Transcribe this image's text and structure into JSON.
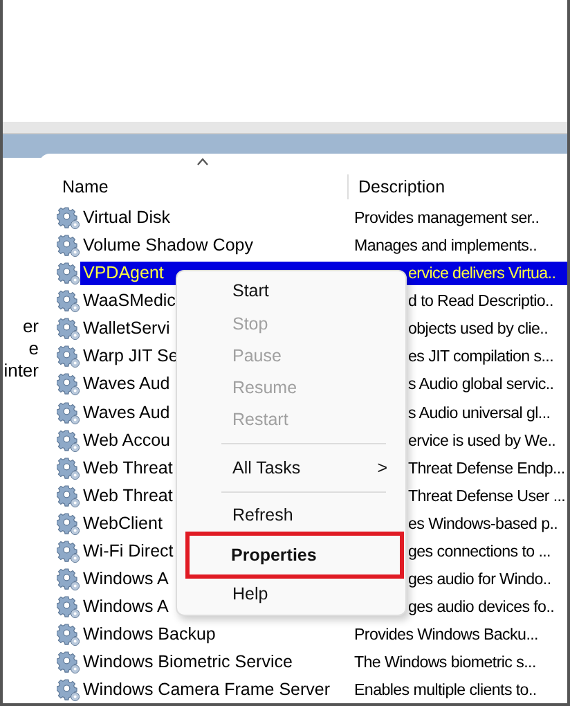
{
  "left_panel_fragments": [
    "er",
    "e",
    "inter"
  ],
  "columns": [
    {
      "label": "Name",
      "sorted": true
    },
    {
      "label": "Description",
      "sorted": false
    }
  ],
  "services": [
    {
      "name": "Virtual Disk",
      "description": "Provides management ser..",
      "selected": false
    },
    {
      "name": "Volume Shadow Copy",
      "description": "Manages and implements..",
      "selected": false
    },
    {
      "name": "VPDAgent",
      "description": "ervice delivers Virtua..",
      "selected": true
    },
    {
      "name": "WaaSMedic",
      "description": "d to Read Descriptio..",
      "selected": false
    },
    {
      "name": "WalletServi",
      "description": "objects used by clie..",
      "selected": false
    },
    {
      "name": "Warp JIT Se",
      "description": "es JIT compilation s...",
      "selected": false
    },
    {
      "name": "Waves Aud",
      "description": "s Audio global servic..",
      "selected": false
    },
    {
      "name": "Waves Aud",
      "description": "s Audio universal gl...",
      "selected": false
    },
    {
      "name": "Web Accou",
      "description": "ervice is used by We..",
      "selected": false
    },
    {
      "name": "Web Threat",
      "description": "Threat Defense Endp...",
      "selected": false
    },
    {
      "name": "Web Threat",
      "description": "Threat Defense User ...",
      "selected": false
    },
    {
      "name": "WebClient",
      "description": "es Windows-based p..",
      "selected": false
    },
    {
      "name": "Wi-Fi Direct",
      "description": "ges connections to ...",
      "selected": false
    },
    {
      "name": "Windows A",
      "description": "ges audio for Windo..",
      "selected": false
    },
    {
      "name": "Windows A",
      "description": "ges audio devices fo..",
      "selected": false
    },
    {
      "name": "Windows Backup",
      "description": "Provides Windows Backu...",
      "selected": false
    },
    {
      "name": "Windows Biometric Service",
      "description": "The Windows biometric s...",
      "selected": false
    },
    {
      "name": "Windows Camera Frame Server",
      "description": "Enables multiple clients to..",
      "selected": false
    }
  ],
  "context_menu": {
    "items": [
      {
        "kind": "item",
        "label": "Start",
        "disabled": false
      },
      {
        "kind": "item",
        "label": "Stop",
        "disabled": true
      },
      {
        "kind": "item",
        "label": "Pause",
        "disabled": true
      },
      {
        "kind": "item",
        "label": "Resume",
        "disabled": true
      },
      {
        "kind": "item",
        "label": "Restart",
        "disabled": true
      },
      {
        "kind": "separator"
      },
      {
        "kind": "submenu",
        "label": "All Tasks",
        "arrow": ">",
        "disabled": false
      },
      {
        "kind": "separator"
      },
      {
        "kind": "item",
        "label": "Refresh",
        "disabled": false
      },
      {
        "kind": "default",
        "label": "Properties",
        "disabled": false,
        "outlined": true
      },
      {
        "kind": "item",
        "label": "Help",
        "disabled": false
      }
    ]
  }
}
